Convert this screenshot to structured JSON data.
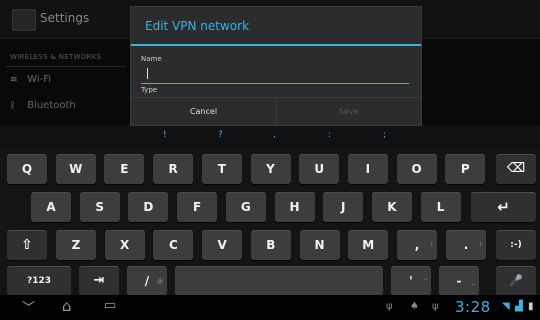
{
  "settings": {
    "title": "Settings",
    "section": "WIRELESS & NETWORKS",
    "items": [
      {
        "label": "Wi-Fi",
        "icon": "wifi-icon",
        "glyph": "≋"
      },
      {
        "label": "Bluetooth",
        "icon": "bluetooth-icon",
        "glyph": "ᛒ"
      }
    ]
  },
  "dialog": {
    "title": "Edit VPN network",
    "name_label": "Name",
    "name_value": "",
    "type_label": "Type",
    "cancel_label": "Cancel",
    "save_label": "Save"
  },
  "keyboard": {
    "suggestions": [
      "!",
      "?",
      ",",
      ":",
      ";"
    ],
    "row1": [
      "Q",
      "W",
      "E",
      "R",
      "T",
      "Y",
      "U",
      "I",
      "O",
      "P"
    ],
    "row2": [
      "A",
      "S",
      "D",
      "F",
      "G",
      "H",
      "J",
      "K",
      "L"
    ],
    "row3": [
      "Z",
      "X",
      "C",
      "V",
      "B",
      "N",
      "M"
    ],
    "keys": {
      "backspace": "⌫",
      "enter": "↵",
      "shift": "⇧",
      "comma": ",",
      "comma_hint": "!",
      "period": ".",
      "period_hint": "?",
      "smiley": ":-)",
      "sym": "?123",
      "tab": "⇥",
      "slash": "/",
      "slash_hint": "@",
      "apostrophe": "'",
      "apostrophe_hint": "\"",
      "dash": "-",
      "dash_hint": "_",
      "mic": "🎤"
    }
  },
  "navbar": {
    "back": "﹀",
    "home": "⌂",
    "recent": "▭",
    "usb1": "ψ",
    "android": "♠",
    "usb2": "ψ",
    "clock": "3:28",
    "wifi": "◥",
    "signal": "▟",
    "battery": "▮"
  },
  "colors": {
    "accent": "#33b5e5"
  }
}
